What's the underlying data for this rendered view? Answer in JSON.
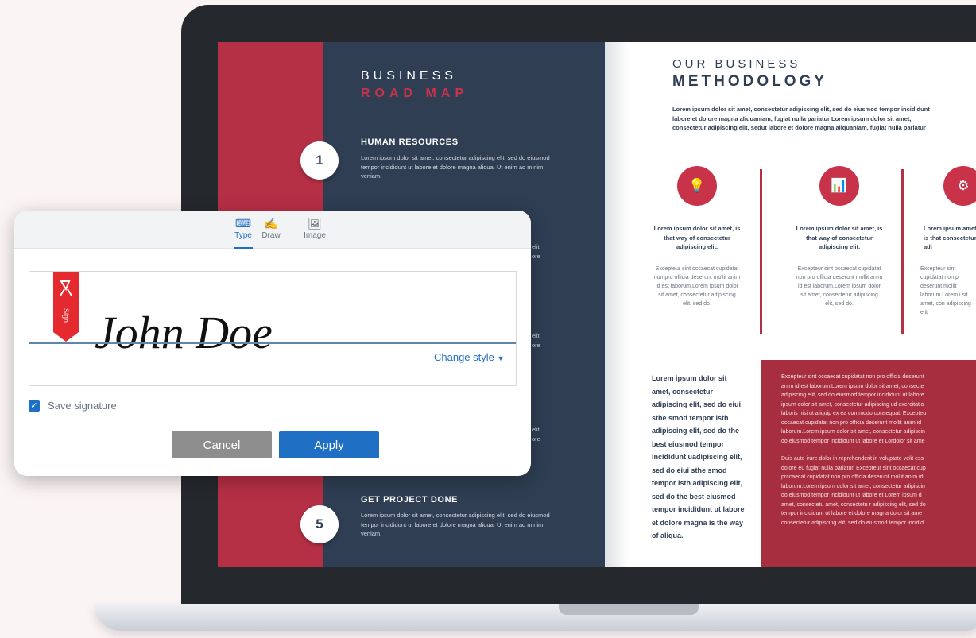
{
  "brochure": {
    "left_title_1": "BUSINESS",
    "left_title_2": "ROAD MAP",
    "steps": [
      {
        "number": "1",
        "title": "HUMAN RESOURCES",
        "text": "Lorem ipsum dolor sit amet, consectetur adipiscing elit, sed do eiusmod tempor incididunt ut labore et dolore magna aliqua. Ut enim ad minim veniam."
      },
      {
        "number": "5",
        "title": "GET PROJECT DONE",
        "text": "Lorem ipsum dolor sit amet, consectetur adipiscing elit, sed do eiusmod tempor incididunt ut labore et dolore magna aliqua. Ut enim ad minim veniam."
      }
    ],
    "partial_snippets": [
      "elit,",
      "ore",
      "elit,",
      "ore",
      "elit,",
      "ore"
    ],
    "right_title_1": "OUR BUSINESS",
    "right_title_2": "METHODOLOGY",
    "intro": [
      "Lorem ipsum dolor sit amet, consectetur adipiscing elit, sed do eiusmod tempor incididunt",
      "labore et dolore magna aliquaniam, fugiat nulla pariatur Lorem ipsum dolor sit amet,",
      "consectetur adipiscing elit, sedut labore et dolore magna aliquaniam, fugiat nulla pariatur"
    ],
    "features": [
      {
        "icon": "lightbulb-icon",
        "glyph": "💡",
        "title": "Lorem ipsum dolor sit amet, is that way of consectetur adipiscing elit.",
        "text": "Excepteur sint occaecat cupidatat non pro officia deserunt mollit anim id est laborum.Lorem ipsum dolor sit amet, consectetur adipiscing elit, sed do."
      },
      {
        "icon": "growth-chart-icon",
        "glyph": "📊",
        "title": "Lorem ipsum dolor sit amet, is that way of consectetur adipiscing elit.",
        "text": "Excepteur sint occaecat cupidatat non pro officia deserunt mollit anim id est laborum.Lorem ipsum dolor sit amet, consectetur adipiscing elit, sed do."
      },
      {
        "icon": "gear-icon",
        "glyph": "⚙",
        "title": "Lorem ipsum amet, is that consectetur adi",
        "text": "Excepteur sint cupidatat non p deserunt mollit laborum.Lorem i sit amet, con adipiscing elit"
      }
    ],
    "bold_block": "Lorem ipsum dolor sit amet, consectetur adipiscing elit, sed do eiui sthe smod tempor isth adipiscing elit, sed do the best eiusmod tempor incididunt uadipiscing elit, sed do eiui sthe smod tempor isth adipiscing elit, sed do the best eiusmod tempor incididunt ut labore et dolore magna is the way of aliqua.",
    "red_box_lines": [
      "Excepteur sint occaecat cupidatat non pro officia deserunt",
      "anim id est laborum.Lorem ipsum dolor sit amet, consecte",
      "adipiscing elit, sed do eiusmod tempor incididunt ut labore",
      "ipsum dolor sit amet, consectetur adipiscing ud exercitatio",
      "laboris nisi ut aliquip ex ea commodo consequat. Excepteu",
      "occaecat cupidatat non pro officia deserunt mollit anim id",
      "laborum.Lorem ipsum dolor sit amet, consectetur adipiscin",
      "do eiusmod tempor incididunt ut labore et Lordolor sit ame",
      "",
      "Duis aute irure dolor in reprehenderit in voluptate velit ess",
      "dolore eu fugiat nulla pariatur. Excepteur sint occaecat cup",
      "prccaecat cupidatat non pro officia deserunt mollit anim id",
      "laborum.Lorem ipsum dolor sit amet, consectetur adipiscin",
      "do eiusmod tempor incididunt ut labore et Lorem ipsum d",
      "amet, consectetu amet, consectetu r adipiscing elit, sed do",
      "tempor incididunt ut labore et dolore magna dolor sit ame",
      "consectetur adipiscing elit, sed do eiusmod tempor incidid"
    ]
  },
  "dialog": {
    "tabs": [
      {
        "label": "Type",
        "icon": "keyboard-icon",
        "active": true
      },
      {
        "label": "Draw",
        "icon": "pen-draw-icon",
        "active": false
      },
      {
        "label": "Image",
        "icon": "image-icon",
        "active": false
      }
    ],
    "signature_text": "John Doe",
    "ribbon_text": "Sign",
    "change_style_label": "Change style",
    "save_signature_label": "Save signature",
    "save_signature_checked": true,
    "cancel_label": "Cancel",
    "apply_label": "Apply"
  },
  "colors": {
    "accent": "#1f6fc4",
    "brand_red": "#b52f45",
    "navy": "#2f3e53"
  }
}
